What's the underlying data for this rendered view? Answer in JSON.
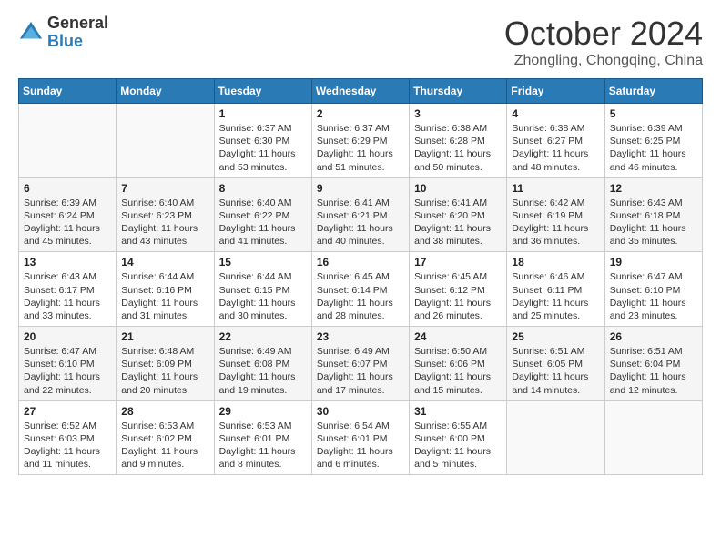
{
  "logo": {
    "general": "General",
    "blue": "Blue"
  },
  "title": "October 2024",
  "subtitle": "Zhongling, Chongqing, China",
  "weekdays": [
    "Sunday",
    "Monday",
    "Tuesday",
    "Wednesday",
    "Thursday",
    "Friday",
    "Saturday"
  ],
  "weeks": [
    [
      {
        "day": "",
        "sunrise": "",
        "sunset": "",
        "daylight": ""
      },
      {
        "day": "",
        "sunrise": "",
        "sunset": "",
        "daylight": ""
      },
      {
        "day": "1",
        "sunrise": "Sunrise: 6:37 AM",
        "sunset": "Sunset: 6:30 PM",
        "daylight": "Daylight: 11 hours and 53 minutes."
      },
      {
        "day": "2",
        "sunrise": "Sunrise: 6:37 AM",
        "sunset": "Sunset: 6:29 PM",
        "daylight": "Daylight: 11 hours and 51 minutes."
      },
      {
        "day": "3",
        "sunrise": "Sunrise: 6:38 AM",
        "sunset": "Sunset: 6:28 PM",
        "daylight": "Daylight: 11 hours and 50 minutes."
      },
      {
        "day": "4",
        "sunrise": "Sunrise: 6:38 AM",
        "sunset": "Sunset: 6:27 PM",
        "daylight": "Daylight: 11 hours and 48 minutes."
      },
      {
        "day": "5",
        "sunrise": "Sunrise: 6:39 AM",
        "sunset": "Sunset: 6:25 PM",
        "daylight": "Daylight: 11 hours and 46 minutes."
      }
    ],
    [
      {
        "day": "6",
        "sunrise": "Sunrise: 6:39 AM",
        "sunset": "Sunset: 6:24 PM",
        "daylight": "Daylight: 11 hours and 45 minutes."
      },
      {
        "day": "7",
        "sunrise": "Sunrise: 6:40 AM",
        "sunset": "Sunset: 6:23 PM",
        "daylight": "Daylight: 11 hours and 43 minutes."
      },
      {
        "day": "8",
        "sunrise": "Sunrise: 6:40 AM",
        "sunset": "Sunset: 6:22 PM",
        "daylight": "Daylight: 11 hours and 41 minutes."
      },
      {
        "day": "9",
        "sunrise": "Sunrise: 6:41 AM",
        "sunset": "Sunset: 6:21 PM",
        "daylight": "Daylight: 11 hours and 40 minutes."
      },
      {
        "day": "10",
        "sunrise": "Sunrise: 6:41 AM",
        "sunset": "Sunset: 6:20 PM",
        "daylight": "Daylight: 11 hours and 38 minutes."
      },
      {
        "day": "11",
        "sunrise": "Sunrise: 6:42 AM",
        "sunset": "Sunset: 6:19 PM",
        "daylight": "Daylight: 11 hours and 36 minutes."
      },
      {
        "day": "12",
        "sunrise": "Sunrise: 6:43 AM",
        "sunset": "Sunset: 6:18 PM",
        "daylight": "Daylight: 11 hours and 35 minutes."
      }
    ],
    [
      {
        "day": "13",
        "sunrise": "Sunrise: 6:43 AM",
        "sunset": "Sunset: 6:17 PM",
        "daylight": "Daylight: 11 hours and 33 minutes."
      },
      {
        "day": "14",
        "sunrise": "Sunrise: 6:44 AM",
        "sunset": "Sunset: 6:16 PM",
        "daylight": "Daylight: 11 hours and 31 minutes."
      },
      {
        "day": "15",
        "sunrise": "Sunrise: 6:44 AM",
        "sunset": "Sunset: 6:15 PM",
        "daylight": "Daylight: 11 hours and 30 minutes."
      },
      {
        "day": "16",
        "sunrise": "Sunrise: 6:45 AM",
        "sunset": "Sunset: 6:14 PM",
        "daylight": "Daylight: 11 hours and 28 minutes."
      },
      {
        "day": "17",
        "sunrise": "Sunrise: 6:45 AM",
        "sunset": "Sunset: 6:12 PM",
        "daylight": "Daylight: 11 hours and 26 minutes."
      },
      {
        "day": "18",
        "sunrise": "Sunrise: 6:46 AM",
        "sunset": "Sunset: 6:11 PM",
        "daylight": "Daylight: 11 hours and 25 minutes."
      },
      {
        "day": "19",
        "sunrise": "Sunrise: 6:47 AM",
        "sunset": "Sunset: 6:10 PM",
        "daylight": "Daylight: 11 hours and 23 minutes."
      }
    ],
    [
      {
        "day": "20",
        "sunrise": "Sunrise: 6:47 AM",
        "sunset": "Sunset: 6:10 PM",
        "daylight": "Daylight: 11 hours and 22 minutes."
      },
      {
        "day": "21",
        "sunrise": "Sunrise: 6:48 AM",
        "sunset": "Sunset: 6:09 PM",
        "daylight": "Daylight: 11 hours and 20 minutes."
      },
      {
        "day": "22",
        "sunrise": "Sunrise: 6:49 AM",
        "sunset": "Sunset: 6:08 PM",
        "daylight": "Daylight: 11 hours and 19 minutes."
      },
      {
        "day": "23",
        "sunrise": "Sunrise: 6:49 AM",
        "sunset": "Sunset: 6:07 PM",
        "daylight": "Daylight: 11 hours and 17 minutes."
      },
      {
        "day": "24",
        "sunrise": "Sunrise: 6:50 AM",
        "sunset": "Sunset: 6:06 PM",
        "daylight": "Daylight: 11 hours and 15 minutes."
      },
      {
        "day": "25",
        "sunrise": "Sunrise: 6:51 AM",
        "sunset": "Sunset: 6:05 PM",
        "daylight": "Daylight: 11 hours and 14 minutes."
      },
      {
        "day": "26",
        "sunrise": "Sunrise: 6:51 AM",
        "sunset": "Sunset: 6:04 PM",
        "daylight": "Daylight: 11 hours and 12 minutes."
      }
    ],
    [
      {
        "day": "27",
        "sunrise": "Sunrise: 6:52 AM",
        "sunset": "Sunset: 6:03 PM",
        "daylight": "Daylight: 11 hours and 11 minutes."
      },
      {
        "day": "28",
        "sunrise": "Sunrise: 6:53 AM",
        "sunset": "Sunset: 6:02 PM",
        "daylight": "Daylight: 11 hours and 9 minutes."
      },
      {
        "day": "29",
        "sunrise": "Sunrise: 6:53 AM",
        "sunset": "Sunset: 6:01 PM",
        "daylight": "Daylight: 11 hours and 8 minutes."
      },
      {
        "day": "30",
        "sunrise": "Sunrise: 6:54 AM",
        "sunset": "Sunset: 6:01 PM",
        "daylight": "Daylight: 11 hours and 6 minutes."
      },
      {
        "day": "31",
        "sunrise": "Sunrise: 6:55 AM",
        "sunset": "Sunset: 6:00 PM",
        "daylight": "Daylight: 11 hours and 5 minutes."
      },
      {
        "day": "",
        "sunrise": "",
        "sunset": "",
        "daylight": ""
      },
      {
        "day": "",
        "sunrise": "",
        "sunset": "",
        "daylight": ""
      }
    ]
  ]
}
